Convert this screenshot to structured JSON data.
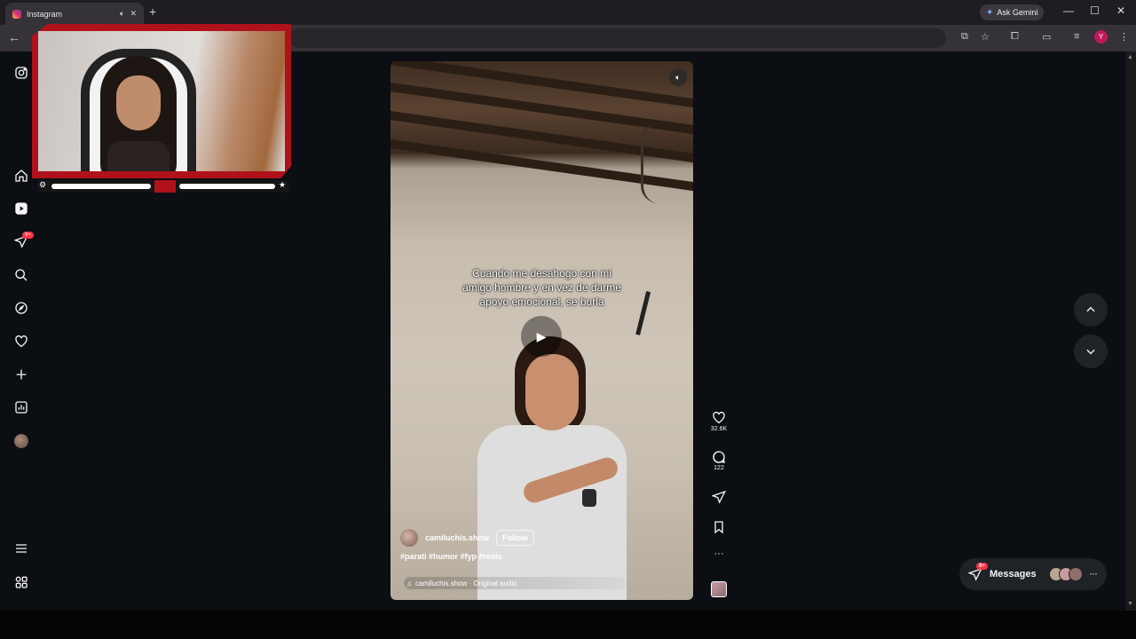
{
  "browser": {
    "tab_title": "Instagram",
    "new_tab": "+",
    "ask_gemini": "Ask Gemini",
    "profile_initial": "Y"
  },
  "sidebar": {
    "notification_badge": "9+"
  },
  "reel": {
    "caption": "Cuando me desahogo con mi amigo hombre y en vez de darme apoyo emocional, se burla",
    "username": "camiluchis.show",
    "follow_label": "Follow",
    "hashtags": "#parati #humor #fyp #reels",
    "audio": "camiluchis.show · Original audio"
  },
  "actions": {
    "likes": "32.6K",
    "comments": "122",
    "more": "···"
  },
  "messages": {
    "label": "Messages",
    "badge": "9+",
    "more": "···"
  },
  "colors": {
    "page_bg": "#0b0e12",
    "webcam_frame": "#b0121b",
    "badge_red": "#ff3040"
  }
}
